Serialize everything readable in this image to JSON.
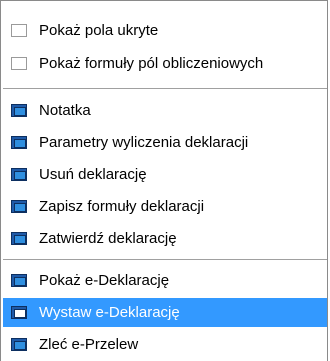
{
  "menu": {
    "groups": [
      [
        {
          "label": "Pokaż pola ukryte",
          "icon": "checkbox-icon"
        },
        {
          "label": "Pokaż formuły pól obliczeniowych",
          "icon": "checkbox-icon"
        }
      ],
      [
        {
          "label": "Notatka",
          "icon": "document-icon"
        },
        {
          "label": "Parametry wyliczenia deklaracji",
          "icon": "document-icon"
        },
        {
          "label": "Usuń deklarację",
          "icon": "document-icon"
        },
        {
          "label": "Zapisz formuły deklaracji",
          "icon": "document-icon"
        },
        {
          "label": "Zatwierdź deklarację",
          "icon": "document-icon"
        }
      ],
      [
        {
          "label": "Pokaż e-Deklarację",
          "icon": "document-icon"
        },
        {
          "label": "Wystaw e-Deklarację",
          "icon": "document-icon",
          "selected": true
        },
        {
          "label": "Zleć e-Przelew",
          "icon": "document-icon"
        }
      ]
    ],
    "highlight_color": "#3399ff"
  }
}
